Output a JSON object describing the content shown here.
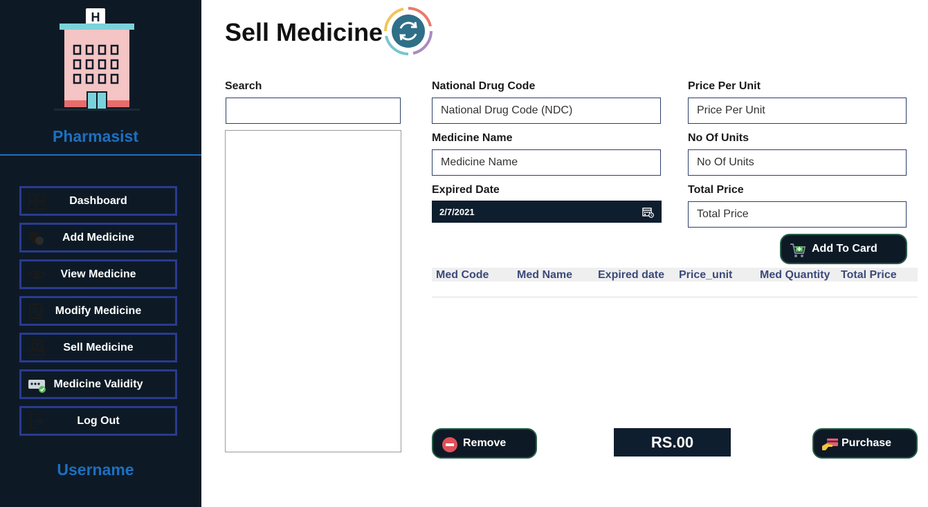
{
  "sidebar": {
    "brand": "Pharmasist",
    "username": "Username",
    "items": [
      {
        "label": "Dashboard",
        "icon": "dashboard-grid-icon"
      },
      {
        "label": "Add Medicine",
        "icon": "capsule-icon"
      },
      {
        "label": "View Medicine",
        "icon": "eye-icon"
      },
      {
        "label": "Modify Medicine",
        "icon": "edit-document-icon"
      },
      {
        "label": "Sell Medicine",
        "icon": "hand-box-icon"
      },
      {
        "label": "Medicine Validity",
        "icon": "validity-check-icon"
      },
      {
        "label": "Log Out",
        "icon": "logout-icon"
      }
    ]
  },
  "main": {
    "title": "Sell Medicine",
    "search": {
      "label": "Search",
      "value": ""
    },
    "fields": {
      "ndc": {
        "label": "National Drug Code",
        "placeholder": "National Drug Code (NDC)"
      },
      "medicine_name": {
        "label": "Medicine Name",
        "placeholder": "Medicine Name"
      },
      "expired_date": {
        "label": "Expired Date",
        "value": "2/7/2021"
      },
      "price_per_unit": {
        "label": "Price Per Unit",
        "placeholder": "Price Per Unit"
      },
      "no_of_units": {
        "label": "No Of Units",
        "placeholder": "No Of Units"
      },
      "total_price": {
        "label": "Total Price",
        "placeholder": "Total Price"
      }
    },
    "add_to_card_label": "Add To Card",
    "grid": {
      "columns": [
        "Med Code",
        "Med Name",
        "Expired date",
        "Price_unit",
        "Med Quantity",
        "Total Price"
      ],
      "rows": []
    },
    "remove_label": "Remove",
    "total_amount": "RS.00",
    "purchase_label": "Purchase"
  },
  "colors": {
    "sidebar_bg": "#0d1a26",
    "accent_blue": "#1e6fc0",
    "nav_border": "#2b3a8f",
    "header_text": "#3b4a7a"
  }
}
